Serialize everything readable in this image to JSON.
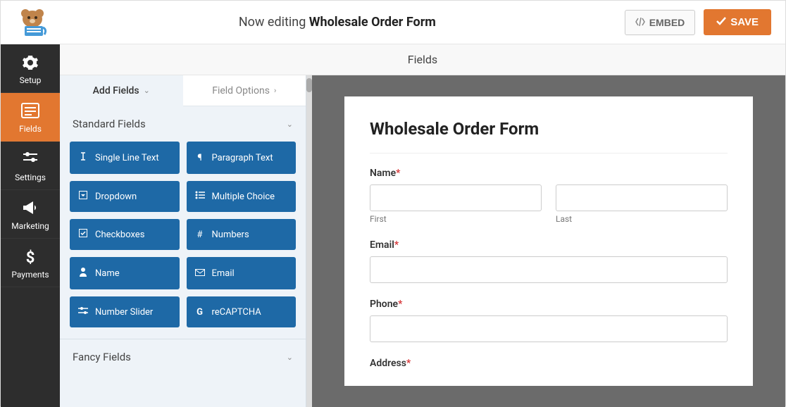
{
  "topbar": {
    "editing_prefix": "Now editing ",
    "form_name": "Wholesale Order Form",
    "embed_label": "EMBED",
    "save_label": "SAVE"
  },
  "left_nav": [
    {
      "label": "Setup"
    },
    {
      "label": "Fields"
    },
    {
      "label": "Settings"
    },
    {
      "label": "Marketing"
    },
    {
      "label": "Payments"
    }
  ],
  "panel_header": "Fields",
  "sub_tabs": {
    "add_fields": "Add Fields",
    "field_options": "Field Options"
  },
  "sections": {
    "standard": "Standard Fields",
    "fancy": "Fancy Fields"
  },
  "standard_fields": [
    {
      "label": "Single Line Text"
    },
    {
      "label": "Paragraph Text"
    },
    {
      "label": "Dropdown"
    },
    {
      "label": "Multiple Choice"
    },
    {
      "label": "Checkboxes"
    },
    {
      "label": "Numbers"
    },
    {
      "label": "Name"
    },
    {
      "label": "Email"
    },
    {
      "label": "Number Slider"
    },
    {
      "label": "reCAPTCHA"
    }
  ],
  "preview": {
    "title": "Wholesale Order Form",
    "fields": {
      "name_label": "Name",
      "first_sub": "First",
      "last_sub": "Last",
      "email_label": "Email",
      "phone_label": "Phone",
      "address_label": "Address",
      "asterisk": "*"
    }
  }
}
